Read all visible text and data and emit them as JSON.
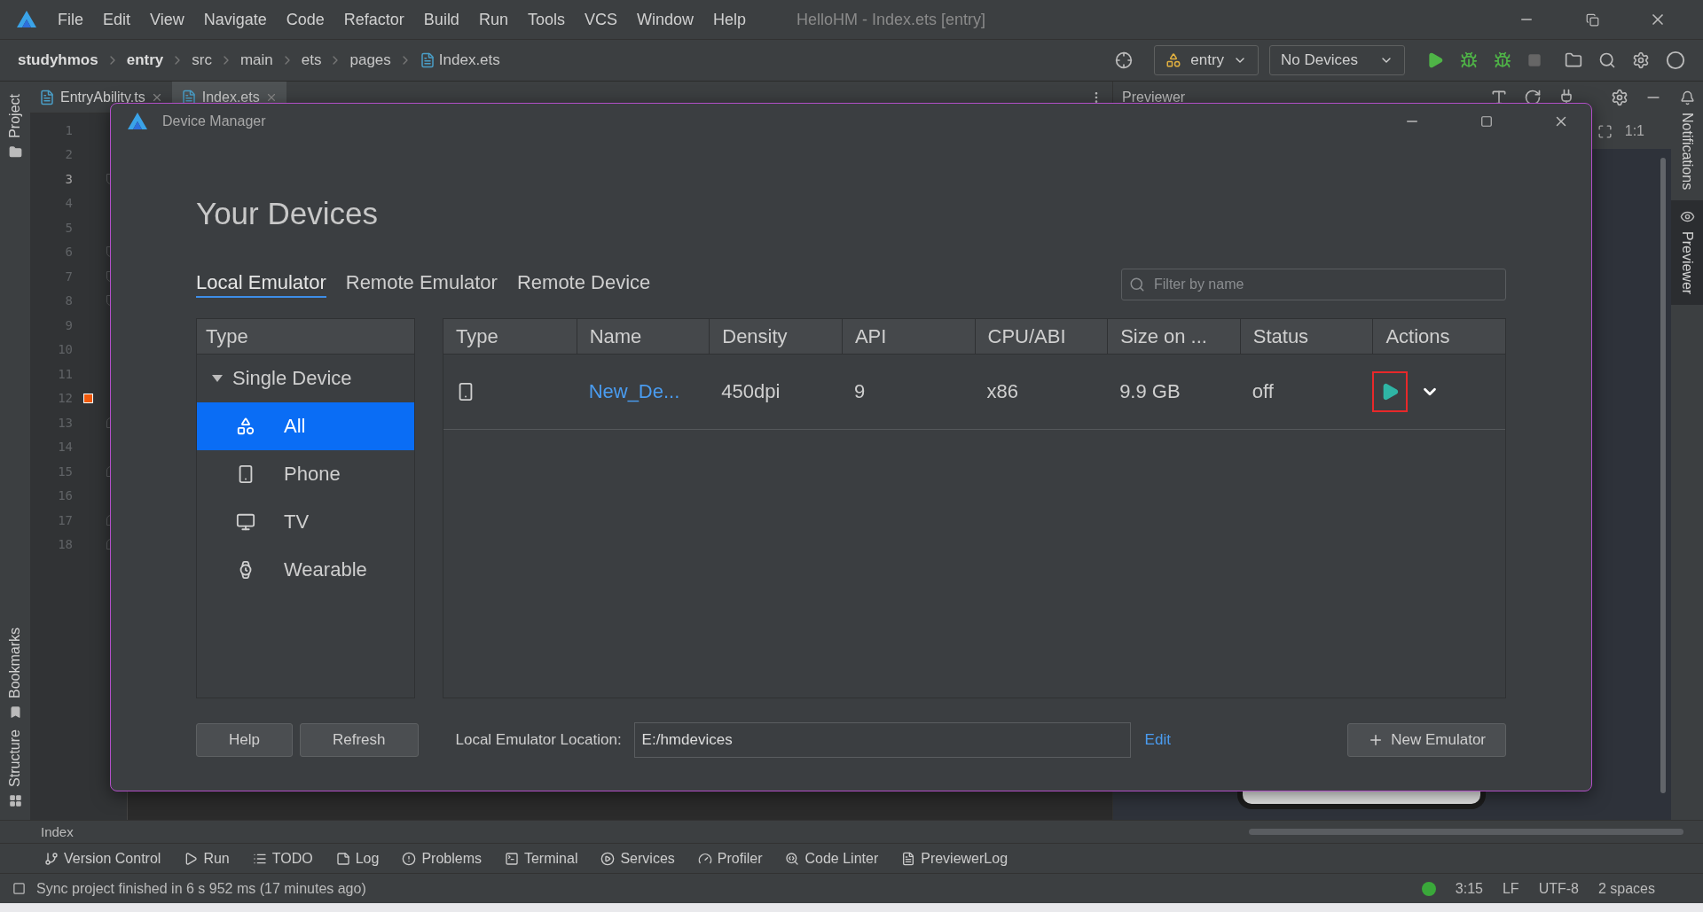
{
  "ide": {
    "title": "HelloHM - Index.ets [entry]",
    "menu": [
      "File",
      "Edit",
      "View",
      "Navigate",
      "Code",
      "Refactor",
      "Build",
      "Run",
      "Tools",
      "VCS",
      "Window",
      "Help"
    ],
    "breadcrumb": [
      "studyhmos",
      "entry",
      "src",
      "main",
      "ets",
      "pages",
      "Index.ets"
    ],
    "run_config": "entry",
    "device_select": "No Devices",
    "editor_tabs": [
      {
        "label": "EntryAbility.ts",
        "selected": false
      },
      {
        "label": "Index.ets",
        "selected": true
      }
    ],
    "lines": [
      {
        "number": "1",
        "current": false,
        "kind": "plain"
      },
      {
        "number": "2",
        "current": false,
        "kind": "plain"
      },
      {
        "number": "3",
        "current": true,
        "kind": "foldstart"
      },
      {
        "number": "4",
        "current": false,
        "kind": "plain"
      },
      {
        "number": "5",
        "current": false,
        "kind": "plain"
      },
      {
        "number": "6",
        "current": false,
        "kind": "foldstart"
      },
      {
        "number": "7",
        "current": false,
        "kind": "foldstart"
      },
      {
        "number": "8",
        "current": false,
        "kind": "foldstart"
      },
      {
        "number": "9",
        "current": false,
        "kind": "plain"
      },
      {
        "number": "10",
        "current": false,
        "kind": "plain"
      },
      {
        "number": "11",
        "current": false,
        "kind": "plain"
      },
      {
        "number": "12",
        "current": false,
        "kind": "plain",
        "marker": true
      },
      {
        "number": "13",
        "current": false,
        "kind": "foldend"
      },
      {
        "number": "14",
        "current": false,
        "kind": "plain"
      },
      {
        "number": "15",
        "current": false,
        "kind": "foldend"
      },
      {
        "number": "16",
        "current": false,
        "kind": "plain"
      },
      {
        "number": "17",
        "current": false,
        "kind": "foldend"
      },
      {
        "number": "18",
        "current": false,
        "kind": "foldend"
      }
    ],
    "left_tools": [
      {
        "label": "Project",
        "kind": "folder"
      },
      {
        "label": "Bookmarks",
        "kind": "bookmark"
      },
      {
        "label": "Structure",
        "kind": "structure"
      }
    ],
    "right_tools": [
      {
        "label": "Notifications",
        "kind": "bell",
        "selected": false
      },
      {
        "label": "Previewer",
        "kind": "eye",
        "selected": true
      }
    ],
    "previewer": {
      "title": "Previewer",
      "zoom_label": "1:1"
    },
    "editor_footer": "Index",
    "tool_windows": [
      {
        "label": "Version Control",
        "kind": "vcs"
      },
      {
        "label": "Run",
        "kind": "run"
      },
      {
        "label": "TODO",
        "kind": "todo"
      },
      {
        "label": "Log",
        "kind": "log"
      },
      {
        "label": "Problems",
        "kind": "problems"
      },
      {
        "label": "Terminal",
        "kind": "terminal"
      },
      {
        "label": "Services",
        "kind": "services"
      },
      {
        "label": "Profiler",
        "kind": "profiler"
      },
      {
        "label": "Code Linter",
        "kind": "linter"
      },
      {
        "label": "PreviewerLog",
        "kind": "doc"
      }
    ],
    "status": {
      "message": "Sync project finished in 6 s 952 ms (17 minutes ago)",
      "position": "3:15",
      "line_ending": "LF",
      "encoding": "UTF-8",
      "indent": "2 spaces"
    }
  },
  "dialog": {
    "title": "Device Manager",
    "heading": "Your Devices",
    "tabs": [
      {
        "label": "Local Emulator",
        "selected": true
      },
      {
        "label": "Remote Emulator",
        "selected": false
      },
      {
        "label": "Remote Device",
        "selected": false
      }
    ],
    "filter": {
      "placeholder": "Filter by name"
    },
    "type_panel": {
      "header": "Type",
      "group": {
        "label": "Single Device",
        "expanded": true,
        "items": [
          {
            "label": "All",
            "kind": "all",
            "selected": true
          },
          {
            "label": "Phone",
            "kind": "phone",
            "selected": false
          },
          {
            "label": "TV",
            "kind": "tv",
            "selected": false
          },
          {
            "label": "Wearable",
            "kind": "watch",
            "selected": false
          }
        ]
      }
    },
    "table": {
      "columns": [
        "Type",
        "Name",
        "Density",
        "API",
        "CPU/ABI",
        "Size on ...",
        "Status",
        "Actions"
      ],
      "rows": [
        {
          "kind": "phone",
          "name": "New_De...",
          "density": "450dpi",
          "api": "9",
          "cpu_abi": "x86",
          "size": "9.9 GB",
          "status": "off",
          "highlighted": true
        }
      ]
    },
    "buttons": [
      "Help",
      "Refresh"
    ],
    "location": {
      "label": "Local Emulator Location:",
      "value": "E:/hmdevices",
      "edit_link": "Edit"
    },
    "new_emulator": "New Emulator"
  }
}
